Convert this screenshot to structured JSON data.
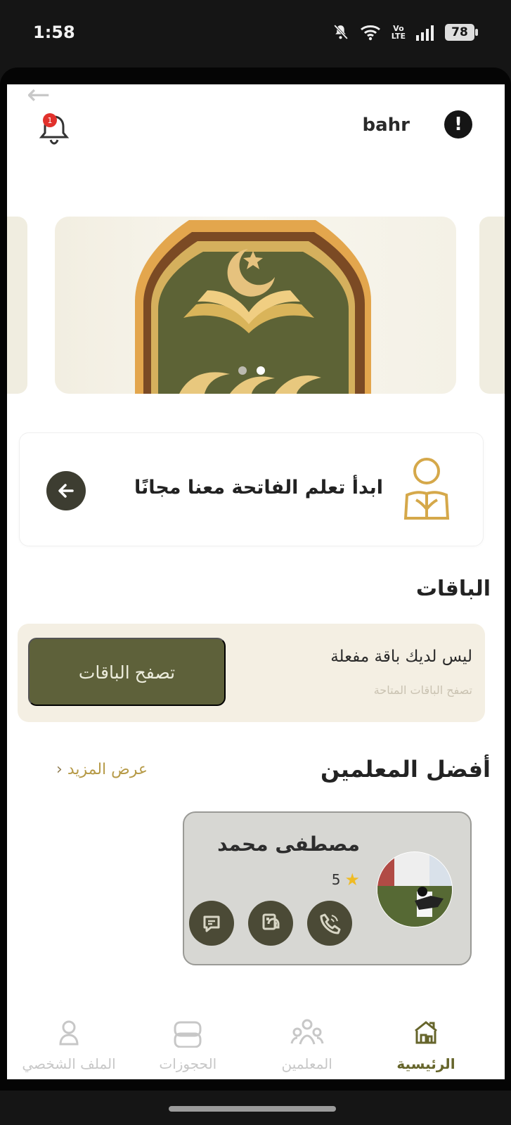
{
  "status_bar": {
    "time": "1:58",
    "battery": "78",
    "network_label_top": "Vo",
    "network_label_bottom": "LTE"
  },
  "header": {
    "username": "bahr",
    "notification_count": "1"
  },
  "promo": {
    "text": "ابدأ تعلم الفاتحة معنا مجانًا"
  },
  "packages": {
    "title": "الباقات",
    "status": "ليس لديك باقة مفعلة",
    "subtitle": "تصفح الباقات المتاحة",
    "button_label": "تصفح الباقات"
  },
  "teachers": {
    "title": "أفضل المعلمين",
    "see_more": "عرض المزيد",
    "list": [
      {
        "name": "مصطفى محمد",
        "rating": "5"
      }
    ]
  },
  "bottom_nav": {
    "items": [
      {
        "label": "الرئيسية",
        "icon": "home-icon",
        "active": true
      },
      {
        "label": "المعلمين",
        "icon": "teachers-icon",
        "active": false
      },
      {
        "label": "الحجوزات",
        "icon": "bookings-icon",
        "active": false
      },
      {
        "label": "الملف الشخصي",
        "icon": "profile-icon",
        "active": false
      }
    ]
  },
  "colors": {
    "accent": "#5e613a",
    "gold": "#b69a47",
    "cream": "#f4efe3"
  }
}
